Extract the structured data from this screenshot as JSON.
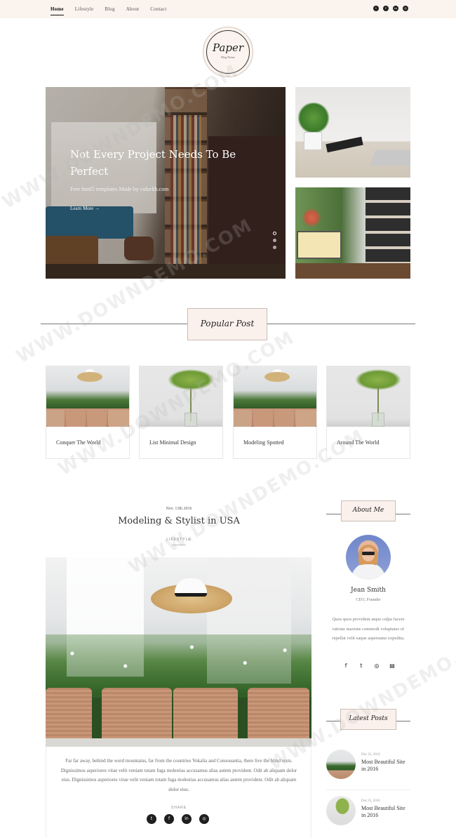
{
  "nav": {
    "items": [
      "Home",
      "Lifestyle",
      "Blog",
      "About",
      "Contact"
    ],
    "social_icons": [
      "twitter-icon",
      "facebook-icon",
      "linkedin-icon",
      "dribbble-icon"
    ]
  },
  "logo": {
    "title": "Paper",
    "subtitle": "Blog Theme"
  },
  "hero": {
    "title": "Not Every Project Needs To Be Perfect",
    "subtitle": "Free html5 templates Made by",
    "subtitle_brand": "colorlib.com",
    "more_label": "Learn More →",
    "slide_count": 3,
    "active_slide": 1
  },
  "popular": {
    "heading": "Popular Post",
    "posts": [
      "Conquer The World",
      "List Minimal Design",
      "Modeling Spotted",
      "Around The World"
    ]
  },
  "post": {
    "date": "Nov. 13th 2016",
    "title": "Modeling & Stylist in USA",
    "category": "LIFESTYLE",
    "body": "Far far away, behind the word mountains, far from the countries Vokalia and Consonantia, there live the blind texts. Dignissimos asperiores vitae velit veniam totam fuga molestias accusamus alias autem provident. Odit ab aliquam dolor eius. Dignissimos asperiores vitae velit veniam totam fuga molestias accusamus alias autem provident. Odit ab aliquam dolor eius.",
    "share_label": "SHARE",
    "share_icons": [
      "twitter-icon",
      "facebook-icon",
      "linkedin-icon",
      "dribbble-icon"
    ]
  },
  "sidebar": {
    "about_heading": "About Me",
    "author_name": "Jean Smith",
    "author_role": "CEO, Founder",
    "author_bio": "Quos quos provident atque culpa facere ratione maxime commodi voluptates of repellat velit eaque aspernatur expedita.",
    "author_social_icons": [
      "facebook-icon",
      "twitter-icon",
      "dribbble-icon",
      "print-icon"
    ],
    "latest_heading": "Latest Posts",
    "latest_posts": [
      {
        "date": "Dec 25, 2016",
        "title": "Most Beautiful Site in 2016"
      },
      {
        "date": "Dec 25, 2016",
        "title": "Most Beautiful Site in 2016"
      }
    ]
  },
  "watermark": "WWW.DOWNDEMO.COM"
}
